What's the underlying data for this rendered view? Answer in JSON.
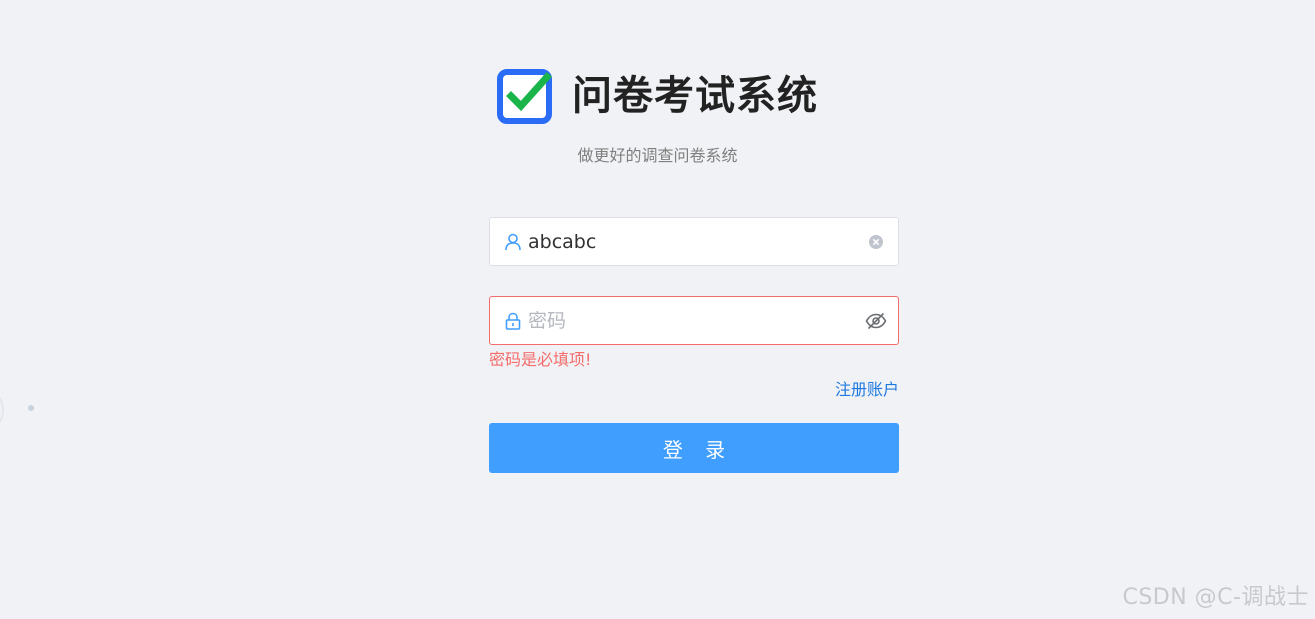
{
  "header": {
    "title": "问卷考试系统",
    "subtitle": "做更好的调查问卷系统"
  },
  "form": {
    "username": {
      "value": "abcabc",
      "icon": "user-icon",
      "suffix_icon": "clear-circle-icon"
    },
    "password": {
      "value": "",
      "placeholder": "密码",
      "icon": "lock-icon",
      "suffix_icon": "eye-off-icon"
    },
    "password_error": "密码是必填项!",
    "register_link": "注册账户",
    "login_button": "登 录"
  },
  "watermark": "CSDN @C-调战士",
  "colors": {
    "primary": "#409eff",
    "error": "#f56c6c",
    "link": "#1f7ae0",
    "logo_blue": "#2b6cf6",
    "logo_check": "#19b44a",
    "background": "#f0f2f5"
  }
}
